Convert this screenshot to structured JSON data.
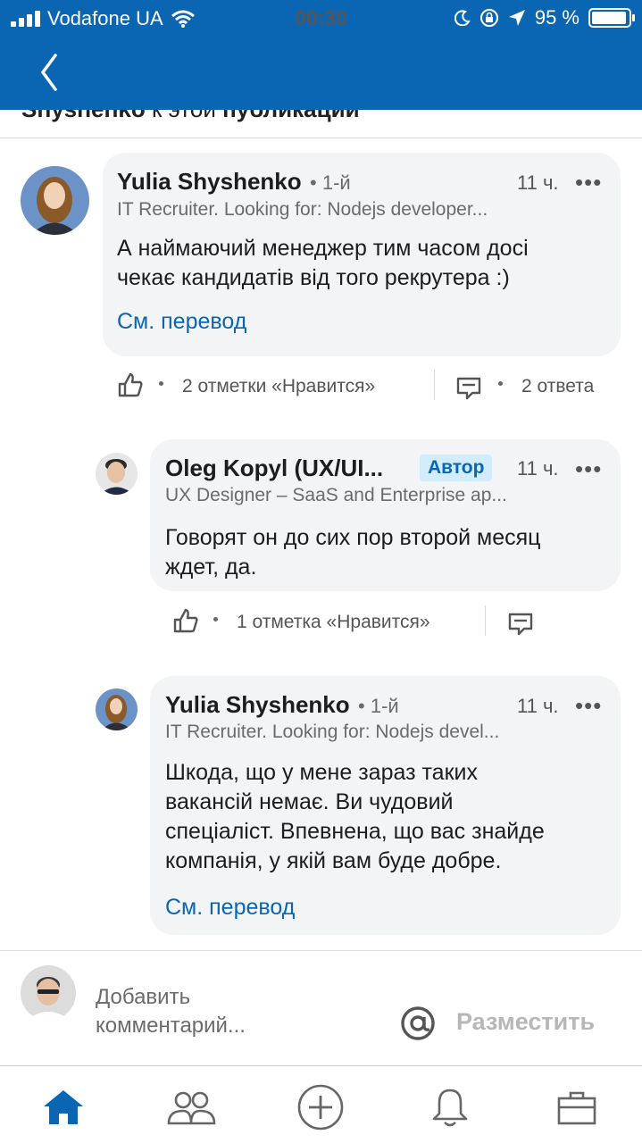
{
  "status_bar": {
    "carrier": "Vodafone UA",
    "time": "00:30",
    "battery_percent": "95 %",
    "battery_level": 0.95
  },
  "cut_heading": {
    "text_prefix": "Shyshenko",
    "text_middle": " к этой ",
    "text_suffix": "публикации"
  },
  "comments": [
    {
      "name": "Yulia Shyshenko",
      "degree": "1-й",
      "time": "11 ч.",
      "headline": "IT Recruiter. Looking for: Nodejs developer...",
      "body_line1": "А наймаючий менеджер тим часом досі",
      "body_line2": "чекає кандидатів від того рекрутера :)",
      "translate": "См. перевод",
      "likes": "2 отметки «Нравится»",
      "replies": "2 ответа"
    },
    {
      "name": "Oleg Kopyl (UX/UI...",
      "badge": "Автор",
      "time": "11 ч.",
      "headline": "UX Designer – SaaS and Enterprise ap...",
      "body_line1": "Говорят он до сих пор второй месяц",
      "body_line2": "ждет, да.",
      "likes": "1 отметка «Нравится»"
    },
    {
      "name": "Yulia Shyshenko",
      "degree": "1-й",
      "time": "11 ч.",
      "headline": "IT Recruiter. Looking for: Nodejs devel...",
      "body_line1": "Шкода, що у мене зараз таких",
      "body_line2": "вакансій немає. Ви чудовий",
      "body_line3": "спеціаліст. Впевнена, що вас знайде",
      "body_line4": "компанія, у якій вам буде добре.",
      "translate": "См. перевод"
    }
  ],
  "compose": {
    "placeholder_line1": "Добавить",
    "placeholder_line2": "комментарий...",
    "post_label": "Разместить"
  },
  "tabs": [
    "home-icon",
    "network-icon",
    "post-icon",
    "notifications-icon",
    "jobs-icon"
  ],
  "colors": {
    "brand": "#0a66b2",
    "bubble": "#f2f4f5",
    "muted": "#6b6b6b"
  }
}
